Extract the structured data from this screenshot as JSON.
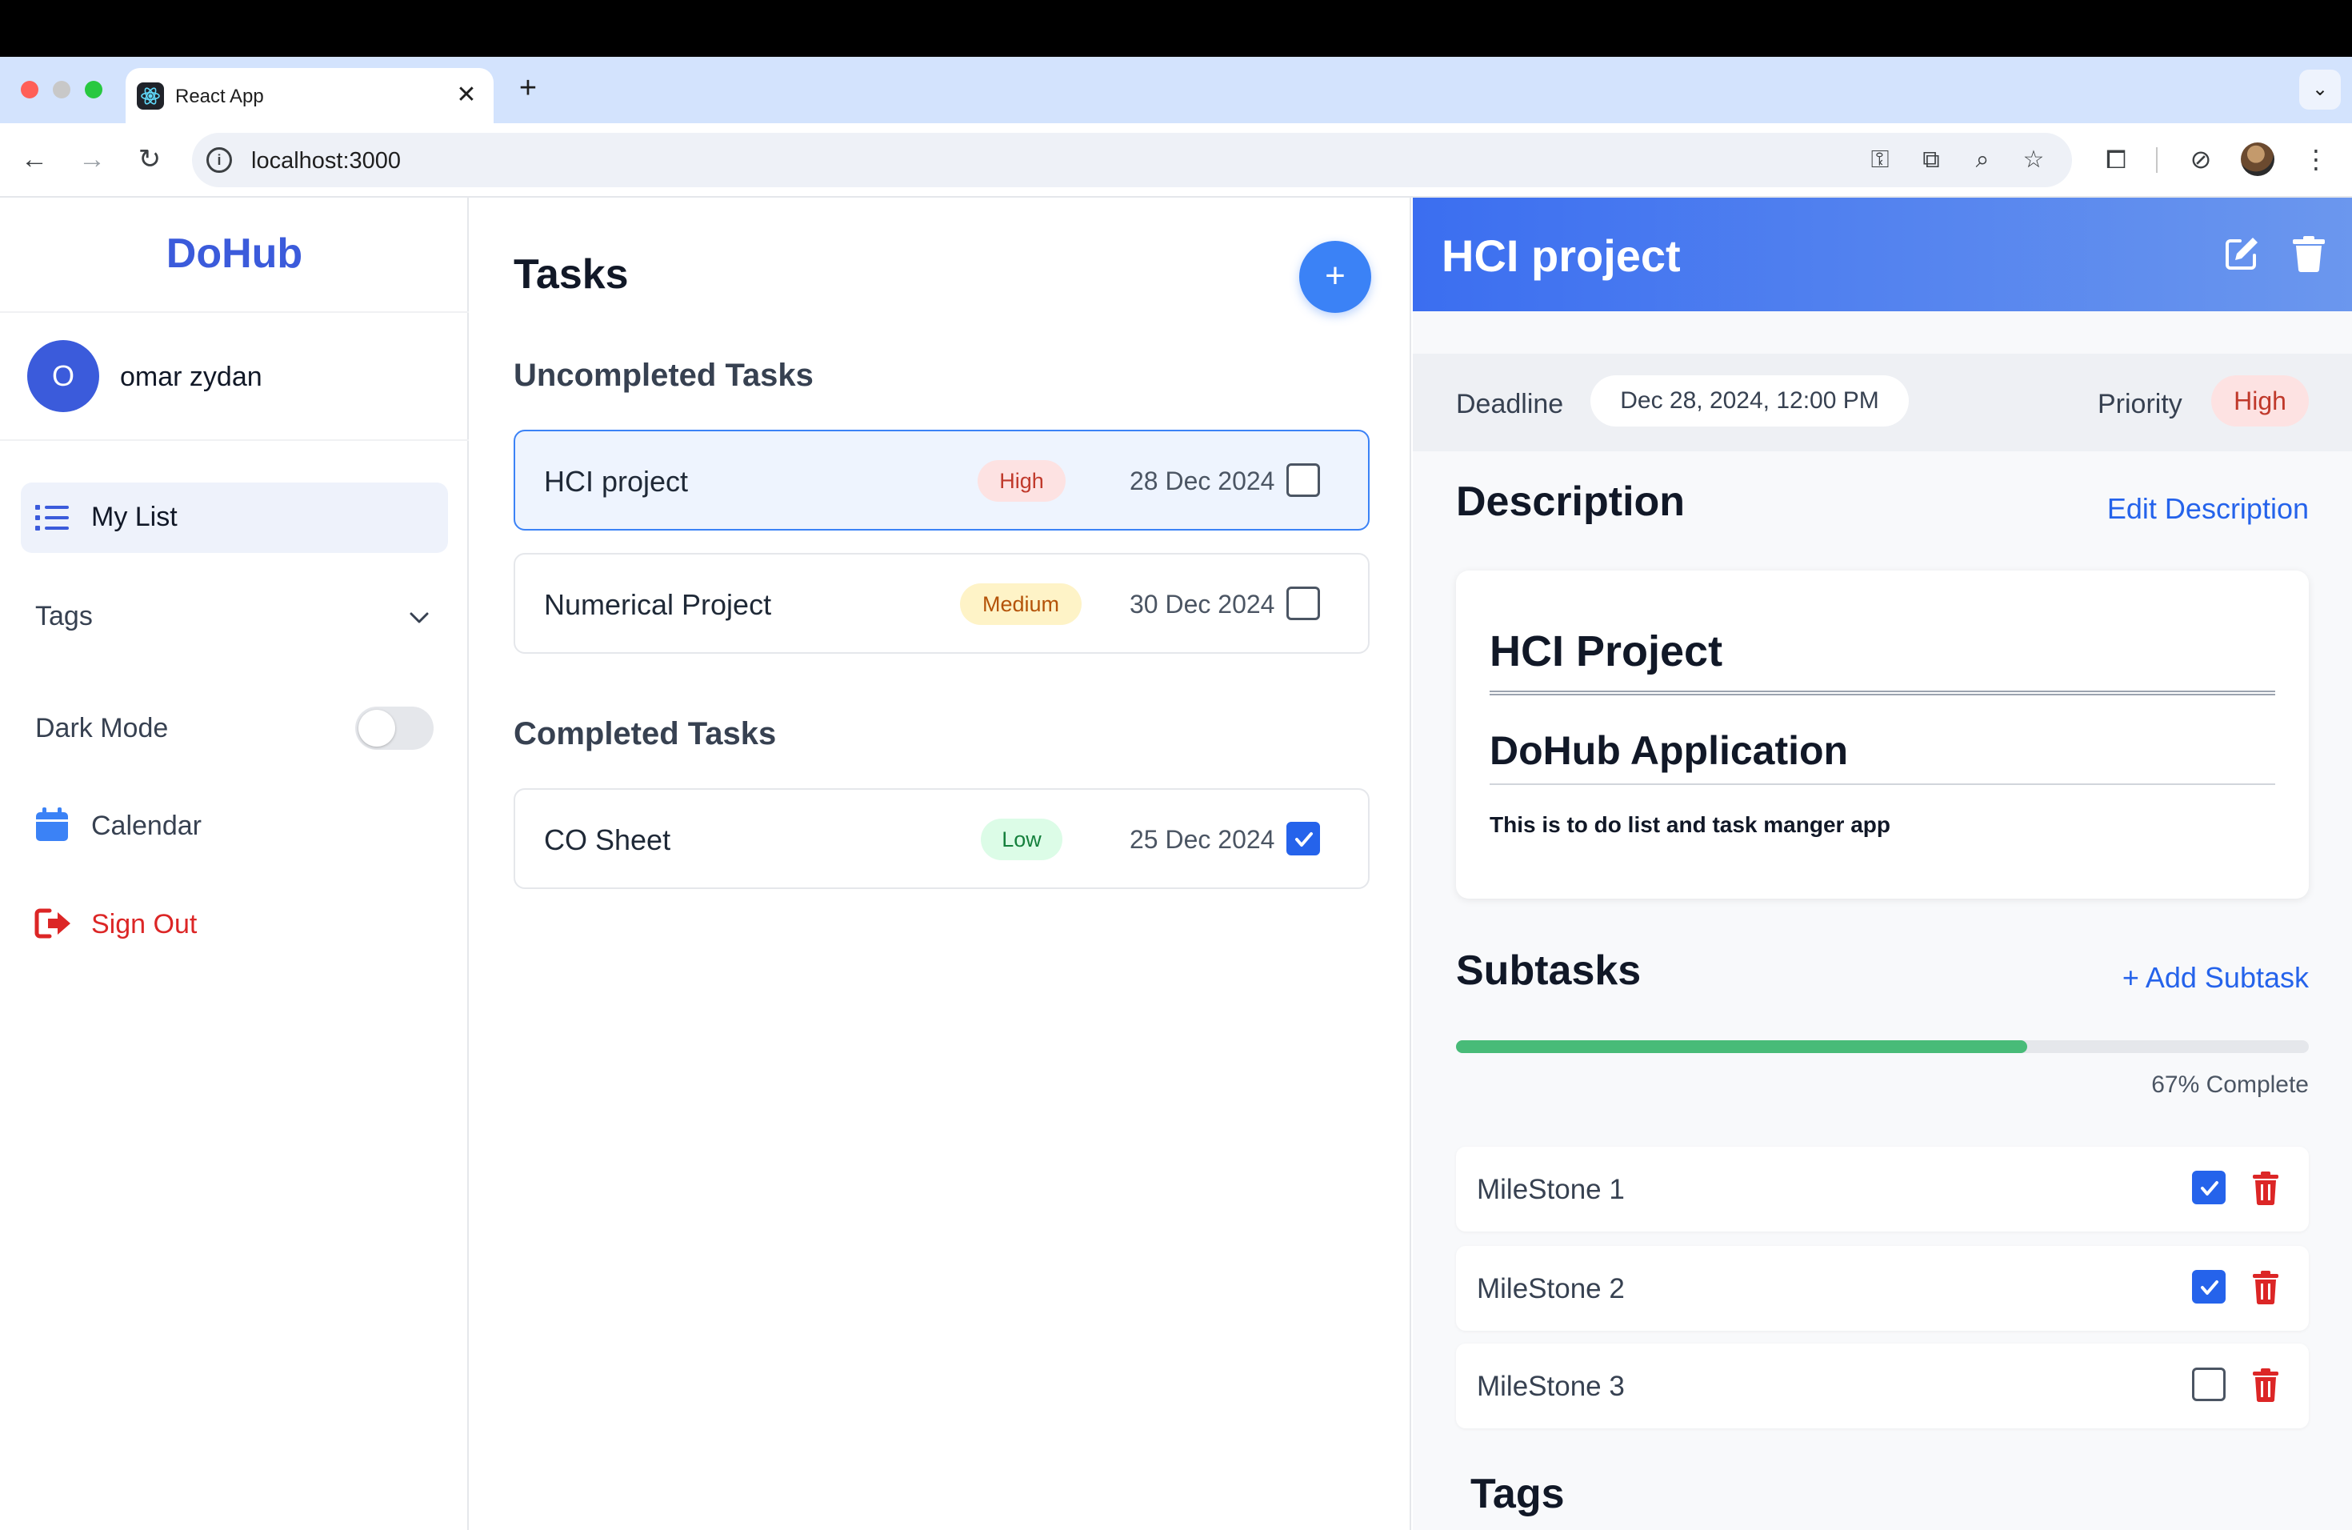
{
  "browser": {
    "tab_title": "React App",
    "tab_close": "✕",
    "new_tab": "+",
    "url": "localhost:3000"
  },
  "sidebar": {
    "brand": "DoHub",
    "user": {
      "initial": "O",
      "name": "omar zydan"
    },
    "items": [
      {
        "label": "My List",
        "icon": "list-icon",
        "active": true
      },
      {
        "label": "Tags",
        "icon": "chevron-down-icon"
      },
      {
        "label": "Dark Mode",
        "icon": "toggle",
        "enabled": false
      },
      {
        "label": "Calendar",
        "icon": "calendar-icon"
      },
      {
        "label": "Sign Out",
        "icon": "sign-out-icon"
      }
    ]
  },
  "tasks": {
    "title": "Tasks",
    "add_label": "+",
    "sections": [
      {
        "title": "Uncompleted Tasks",
        "items": [
          {
            "name": "HCI project",
            "priority": "High",
            "date": "28 Dec 2024",
            "done": false,
            "selected": true
          },
          {
            "name": "Numerical Project",
            "priority": "Medium",
            "date": "30 Dec 2024",
            "done": false,
            "selected": false
          }
        ]
      },
      {
        "title": "Completed Tasks",
        "items": [
          {
            "name": "CO Sheet",
            "priority": "Low",
            "date": "25 Dec 2024",
            "done": true,
            "selected": false
          }
        ]
      }
    ]
  },
  "detail": {
    "title": "HCI project",
    "deadline_label": "Deadline",
    "deadline_value": "Dec 28, 2024, 12:00 PM",
    "priority_label": "Priority",
    "priority_value": "High",
    "description": {
      "title": "Description",
      "edit_label": "Edit Description",
      "h1": "HCI Project",
      "h2": "DoHub Application",
      "body": "This is to do list and task manger app"
    },
    "subtasks": {
      "title": "Subtasks",
      "add_label": "+ Add Subtask",
      "progress_fraction": 0.67,
      "progress_text": "67% Complete",
      "items": [
        {
          "name": "MileStone 1",
          "done": true
        },
        {
          "name": "MileStone 2",
          "done": true
        },
        {
          "name": "MileStone 3",
          "done": false
        }
      ]
    },
    "tags_title": "Tags"
  },
  "colors": {
    "accent": "#3b5bdb",
    "primary_button": "#3b82f6",
    "checkbox_checked": "#2563eb",
    "danger": "#dc2626",
    "progress": "#48bb78",
    "priority_high_bg": "#fde2e2",
    "priority_medium_bg": "#fef3c7",
    "priority_low_bg": "#dcfce7"
  }
}
